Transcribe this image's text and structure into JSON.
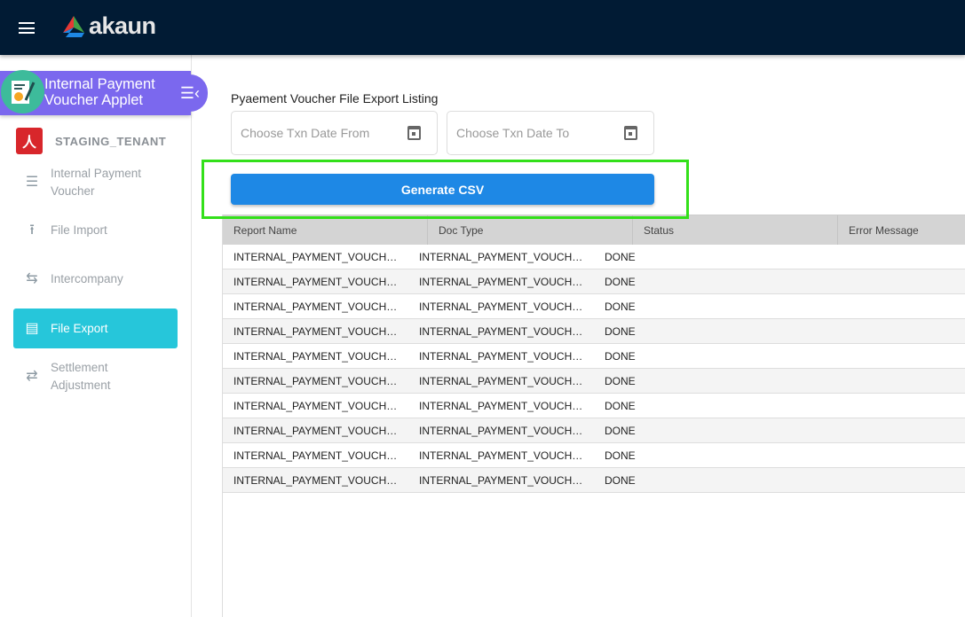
{
  "header": {
    "logo_text": "akaun"
  },
  "sidebar": {
    "applet_title_line1": "Internal Payment",
    "applet_title_line2": "Voucher Applet",
    "tenant": "STAGING_TENANT",
    "items": [
      {
        "label_line1": "Internal Payment",
        "label_line2": "Voucher",
        "icon": "list-icon"
      },
      {
        "label_line1": "File Import",
        "icon": "upload-icon"
      },
      {
        "label_line1": "Intercompany",
        "icon": "compare-arrows-icon"
      },
      {
        "label_line1": "File Export",
        "icon": "list-alt-icon",
        "active": true
      },
      {
        "label_line1": "Settlement",
        "label_line2": "Adjustment",
        "icon": "swap-icon"
      }
    ]
  },
  "main": {
    "title": "Pyaement Voucher File Export Listing",
    "date_from_placeholder": "Choose Txn Date From",
    "date_to_placeholder": "Choose Txn Date To",
    "generate_label": "Generate CSV",
    "columns": [
      "Report Name",
      "Doc Type",
      "Status",
      "Error Message"
    ],
    "rows": [
      [
        "INTERNAL_PAYMENT_VOUCHER_EXPO...",
        "INTERNAL_PAYMENT_VOUCHER",
        "DONE",
        ""
      ],
      [
        "INTERNAL_PAYMENT_VOUCHER_EXPO...",
        "INTERNAL_PAYMENT_VOUCHER",
        "DONE",
        ""
      ],
      [
        "INTERNAL_PAYMENT_VOUCHER_EXPO...",
        "INTERNAL_PAYMENT_VOUCHER",
        "DONE",
        ""
      ],
      [
        "INTERNAL_PAYMENT_VOUCHER_EXPO...",
        "INTERNAL_PAYMENT_VOUCHER",
        "DONE",
        ""
      ],
      [
        "INTERNAL_PAYMENT_VOUCHER_EXPO...",
        "INTERNAL_PAYMENT_VOUCHER",
        "DONE",
        ""
      ],
      [
        "INTERNAL_PAYMENT_VOUCHER_EXPO...",
        "INTERNAL_PAYMENT_VOUCHER",
        "DONE",
        ""
      ],
      [
        "INTERNAL_PAYMENT_VOUCHER_EXPO...",
        "INTERNAL_PAYMENT_VOUCHER",
        "DONE",
        ""
      ],
      [
        "INTERNAL_PAYMENT_VOUCHER_EXPO...",
        "INTERNAL_PAYMENT_VOUCHER",
        "DONE",
        ""
      ],
      [
        "INTERNAL_PAYMENT_VOUCHER_EXPO...",
        "INTERNAL_PAYMENT_VOUCHER",
        "DONE",
        ""
      ],
      [
        "INTERNAL_PAYMENT_VOUCHER_EXPO...",
        "INTERNAL_PAYMENT_VOUCHER",
        "DONE",
        ""
      ]
    ]
  }
}
